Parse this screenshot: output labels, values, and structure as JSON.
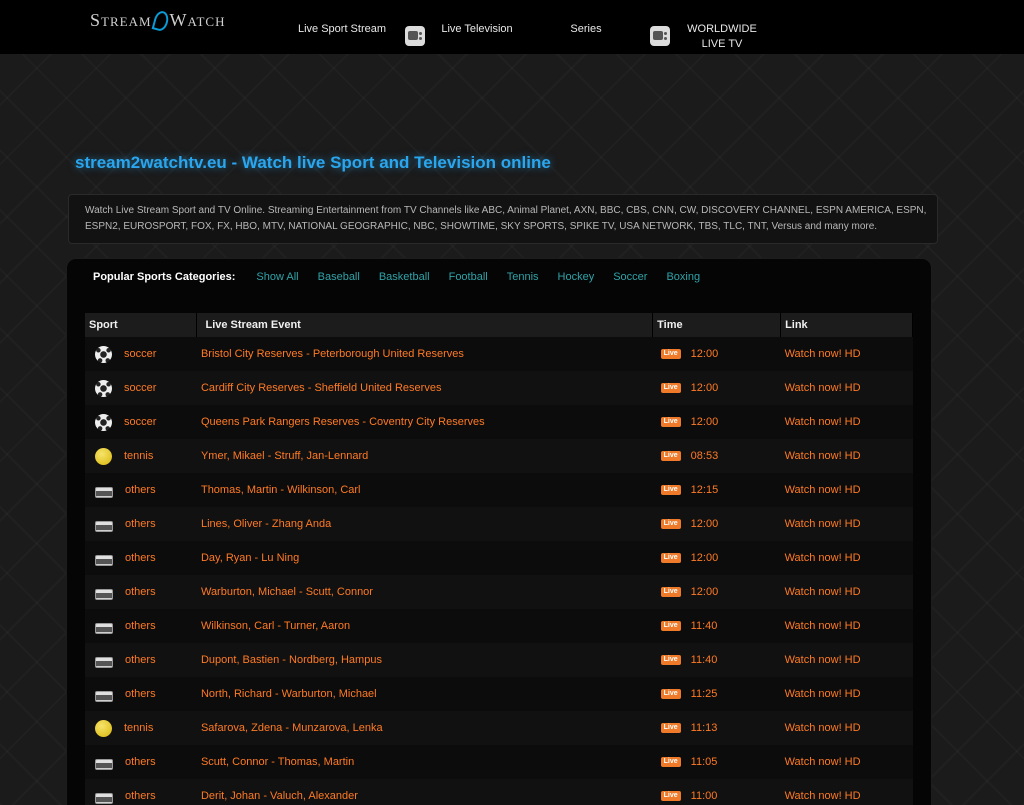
{
  "header": {
    "logo_left": "Stream",
    "logo_right": "Watch",
    "nav": [
      {
        "label": "Live Sport Stream"
      },
      {
        "label": "Live Television"
      },
      {
        "label": "Series"
      },
      {
        "label": "WORLDWIDE LIVE TV"
      }
    ]
  },
  "headline": "stream2watchtv.eu - Watch live Sport and Television online",
  "description": "Watch Live Stream Sport and TV Online. Streaming Entertainment from TV Channels like ABC, Animal Planet, AXN, BBC, CBS, CNN, CW, DISCOVERY CHANNEL, ESPN AMERICA, ESPN, ESPN2, EUROSPORT, FOX, FX, HBO, MTV, NATIONAL GEOGRAPHIC, NBC, SHOWTIME, SKY SPORTS, SPIKE TV, USA NETWORK, TBS, TLC, TNT, Versus and many more.",
  "categories": {
    "label": "Popular Sports Categories:",
    "items": [
      "Show All",
      "Baseball",
      "Basketball",
      "Football",
      "Tennis",
      "Hockey",
      "Soccer",
      "Boxing"
    ]
  },
  "table": {
    "headers": [
      "Sport",
      "Live Stream Event",
      "Time",
      "Link"
    ],
    "live_label": "Live",
    "rows": [
      {
        "icon": "soccer-ball-icon",
        "sport": "soccer",
        "event": "Bristol City Reserves - Peterborough United Reserves",
        "time": "12:00",
        "link": "Watch now! HD"
      },
      {
        "icon": "soccer-ball-icon",
        "sport": "soccer",
        "event": "Cardiff City Reserves - Sheffield United Reserves",
        "time": "12:00",
        "link": "Watch now! HD"
      },
      {
        "icon": "soccer-ball-icon",
        "sport": "soccer",
        "event": "Queens Park Rangers Reserves - Coventry City Reserves",
        "time": "12:00",
        "link": "Watch now! HD"
      },
      {
        "icon": "tennis-ball-icon",
        "sport": "tennis",
        "event": "Ymer, Mikael - Struff, Jan-Lennard",
        "time": "08:53",
        "link": "Watch now! HD"
      },
      {
        "icon": "laptop-icon",
        "sport": "others",
        "event": "Thomas, Martin - Wilkinson, Carl",
        "time": "12:15",
        "link": "Watch now! HD"
      },
      {
        "icon": "laptop-icon",
        "sport": "others",
        "event": "Lines, Oliver - Zhang Anda",
        "time": "12:00",
        "link": "Watch now! HD"
      },
      {
        "icon": "laptop-icon",
        "sport": "others",
        "event": "Day, Ryan - Lu Ning",
        "time": "12:00",
        "link": "Watch now! HD"
      },
      {
        "icon": "laptop-icon",
        "sport": "others",
        "event": "Warburton, Michael - Scutt, Connor",
        "time": "12:00",
        "link": "Watch now! HD"
      },
      {
        "icon": "laptop-icon",
        "sport": "others",
        "event": "Wilkinson, Carl - Turner, Aaron",
        "time": "11:40",
        "link": "Watch now! HD"
      },
      {
        "icon": "laptop-icon",
        "sport": "others",
        "event": "Dupont, Bastien - Nordberg, Hampus",
        "time": "11:40",
        "link": "Watch now! HD"
      },
      {
        "icon": "laptop-icon",
        "sport": "others",
        "event": "North, Richard - Warburton, Michael",
        "time": "11:25",
        "link": "Watch now! HD"
      },
      {
        "icon": "tennis-ball-icon",
        "sport": "tennis",
        "event": "Safarova, Zdena - Munzarova, Lenka",
        "time": "11:13",
        "link": "Watch now! HD"
      },
      {
        "icon": "laptop-icon",
        "sport": "others",
        "event": "Scutt, Connor - Thomas, Martin",
        "time": "11:05",
        "link": "Watch now! HD"
      },
      {
        "icon": "laptop-icon",
        "sport": "others",
        "event": "Derit, Johan - Valuch, Alexander",
        "time": "11:00",
        "link": "Watch now! HD"
      }
    ]
  }
}
